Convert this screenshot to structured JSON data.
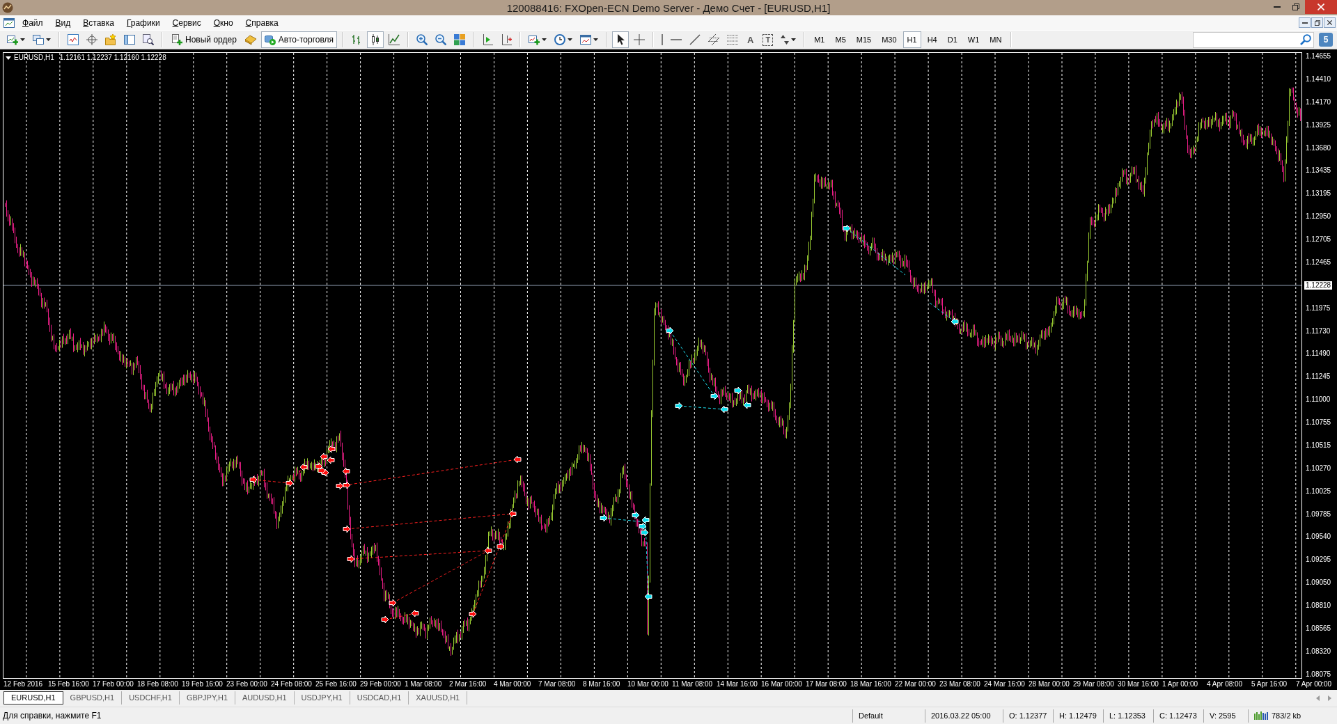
{
  "window": {
    "title": "120088416: FXOpen-ECN Demo Server - Демо Счет - [EURUSD,H1]"
  },
  "menu": [
    "Файл",
    "Вид",
    "Вставка",
    "Графики",
    "Сервис",
    "Окно",
    "Справка"
  ],
  "toolbar": {
    "new_order": "Новый ордер",
    "auto_trading": {
      "label": "Авто-торговля",
      "on": true
    },
    "chart_types": [
      {
        "selected": false
      },
      {
        "selected": true
      },
      {
        "selected": false
      }
    ],
    "pointer_tools": [
      {
        "selected": true
      },
      {
        "selected": false
      }
    ],
    "text_tool": "A",
    "label_tool": "T",
    "timeframes": [
      {
        "label": "M1",
        "selected": false
      },
      {
        "label": "M5",
        "selected": false
      },
      {
        "label": "M15",
        "selected": false
      },
      {
        "label": "M30",
        "selected": false
      },
      {
        "label": "H1",
        "selected": true
      },
      {
        "label": "H4",
        "selected": false
      },
      {
        "label": "D1",
        "selected": false
      },
      {
        "label": "W1",
        "selected": false
      },
      {
        "label": "MN",
        "selected": false
      }
    ],
    "community_badge": "5"
  },
  "chart": {
    "symbol": "EURUSD,H1",
    "readout": "1.12161 1.12237 1.12160 1.12228",
    "price_axis": [
      {
        "label": "1.14655",
        "kind": "tick"
      },
      {
        "label": "1.14410",
        "kind": "tick"
      },
      {
        "label": "1.14170",
        "kind": "tick"
      },
      {
        "label": "1.13925",
        "kind": "tick"
      },
      {
        "label": "1.13680",
        "kind": "tick"
      },
      {
        "label": "1.13435",
        "kind": "tick"
      },
      {
        "label": "1.13195",
        "kind": "tick"
      },
      {
        "label": "1.12950",
        "kind": "tick"
      },
      {
        "label": "1.12705",
        "kind": "tick"
      },
      {
        "label": "1.12465",
        "kind": "tick"
      },
      {
        "label": "1.12228",
        "kind": "current"
      },
      {
        "label": "1.11975",
        "kind": "tick"
      },
      {
        "label": "1.11730",
        "kind": "tick"
      },
      {
        "label": "1.11490",
        "kind": "tick"
      },
      {
        "label": "1.11245",
        "kind": "tick"
      },
      {
        "label": "1.11000",
        "kind": "tick"
      },
      {
        "label": "1.10755",
        "kind": "tick"
      },
      {
        "label": "1.10515",
        "kind": "tick"
      },
      {
        "label": "1.10270",
        "kind": "tick"
      },
      {
        "label": "1.10025",
        "kind": "tick"
      },
      {
        "label": "1.09785",
        "kind": "tick"
      },
      {
        "label": "1.09540",
        "kind": "tick"
      },
      {
        "label": "1.09295",
        "kind": "tick"
      },
      {
        "label": "1.09050",
        "kind": "tick"
      },
      {
        "label": "1.08810",
        "kind": "tick"
      },
      {
        "label": "1.08565",
        "kind": "tick"
      },
      {
        "label": "1.08320",
        "kind": "tick"
      },
      {
        "label": "1.08075",
        "kind": "tick"
      }
    ],
    "time_axis": [
      "12 Feb 2016",
      "15 Feb 16:00",
      "17 Feb 00:00",
      "18 Feb 08:00",
      "19 Feb 16:00",
      "23 Feb 00:00",
      "24 Feb 08:00",
      "25 Feb 16:00",
      "29 Feb 00:00",
      "1 Mar 08:00",
      "2 Mar 16:00",
      "4 Mar 00:00",
      "7 Mar 08:00",
      "8 Mar 16:00",
      "10 Mar 00:00",
      "11 Mar 08:00",
      "14 Mar 16:00",
      "16 Mar 00:00",
      "17 Mar 08:00",
      "18 Mar 16:00",
      "22 Mar 00:00",
      "23 Mar 08:00",
      "24 Mar 16:00",
      "28 Mar 00:00",
      "29 Mar 08:00",
      "30 Mar 16:00",
      "1 Apr 00:00",
      "4 Apr 08:00",
      "5 Apr 16:00",
      "7 Apr 00:00"
    ]
  },
  "tabs": [
    {
      "label": "EURUSD,H1",
      "selected": true
    },
    {
      "label": "GBPUSD,H1",
      "selected": false
    },
    {
      "label": "USDCHF,H1",
      "selected": false
    },
    {
      "label": "GBPJPY,H1",
      "selected": false
    },
    {
      "label": "AUDUSD,H1",
      "selected": false
    },
    {
      "label": "USDJPY,H1",
      "selected": false
    },
    {
      "label": "USDCAD,H1",
      "selected": false
    },
    {
      "label": "XAUUSD,H1",
      "selected": false
    }
  ],
  "status_bar": {
    "help": "Для справки, нажмите F1",
    "fields": [
      {
        "text": "Default",
        "kind": "plain"
      },
      {
        "text": "2016.03.22 05:00",
        "kind": "plain"
      },
      {
        "text": "O: 1.12377",
        "kind": "plain"
      },
      {
        "text": "H: 1.12479",
        "kind": "plain"
      },
      {
        "text": "L: 1.12353",
        "kind": "plain"
      },
      {
        "text": "C: 1.12473",
        "kind": "plain"
      },
      {
        "text": "V: 2595",
        "kind": "plain"
      },
      {
        "text": "783/2 kb",
        "kind": "connection"
      }
    ]
  }
}
